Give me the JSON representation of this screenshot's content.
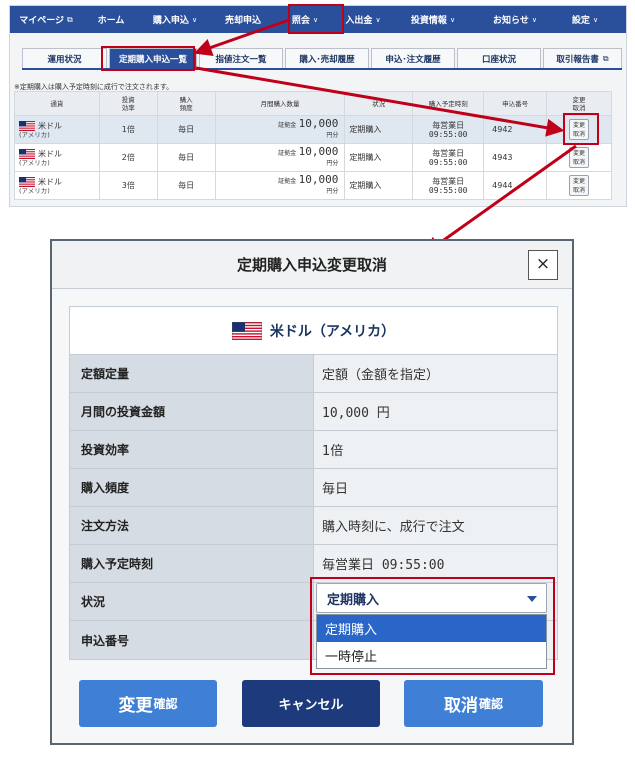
{
  "nav": {
    "items": [
      {
        "label": "マイページ",
        "suffix": "ext"
      },
      {
        "label": "ホーム",
        "suffix": ""
      },
      {
        "label": "購入申込",
        "suffix": "chev"
      },
      {
        "label": "売却申込",
        "suffix": ""
      },
      {
        "label": "照会",
        "suffix": "chev"
      },
      {
        "label": "入出金",
        "suffix": "chev"
      },
      {
        "label": "投資情報",
        "suffix": "chev"
      },
      {
        "label": "お知らせ",
        "suffix": "chev"
      },
      {
        "label": "設定",
        "suffix": "chev"
      }
    ]
  },
  "tabs": [
    {
      "label": "運用状況",
      "active": false,
      "ext": false
    },
    {
      "label": "定期購入申込一覧",
      "active": true,
      "ext": false
    },
    {
      "label": "指値注文一覧",
      "active": false,
      "ext": false
    },
    {
      "label": "購入･売却履歴",
      "active": false,
      "ext": false
    },
    {
      "label": "申込･注文履歴",
      "active": false,
      "ext": false
    },
    {
      "label": "口座状況",
      "active": false,
      "ext": false
    },
    {
      "label": "取引報告書",
      "active": false,
      "ext": true
    }
  ],
  "note": "※定期購入は購入予定時刻に成行で注文されます。",
  "table": {
    "headers": [
      "通貨",
      "投資\n効率",
      "購入\n頻度",
      "月間購入数量",
      "状況",
      "購入予定時刻",
      "申込番号",
      "変更\n取消"
    ],
    "rows": [
      {
        "currency": "米ドル",
        "region": "(アメリカ)",
        "efficiency": "1倍",
        "frequency": "毎日",
        "amount_label": "証拠金",
        "amount": "10,000",
        "amount_unit": "円分",
        "status": "定期購入",
        "time_day": "毎営業日",
        "time": "09:55:00",
        "id": "4942",
        "action": "変更\n取消"
      },
      {
        "currency": "米ドル",
        "region": "(アメリカ)",
        "efficiency": "2倍",
        "frequency": "毎日",
        "amount_label": "証拠金",
        "amount": "10,000",
        "amount_unit": "円分",
        "status": "定期購入",
        "time_day": "毎営業日",
        "time": "09:55:00",
        "id": "4943",
        "action": "変更\n取消"
      },
      {
        "currency": "米ドル",
        "region": "(アメリカ)",
        "efficiency": "3倍",
        "frequency": "毎日",
        "amount_label": "証拠金",
        "amount": "10,000",
        "amount_unit": "円分",
        "status": "定期購入",
        "time_day": "毎営業日",
        "time": "09:55:00",
        "id": "4944",
        "action": "変更\n取消"
      }
    ]
  },
  "modal": {
    "title": "定期購入申込変更取消",
    "close": "×",
    "currency": "米ドル（アメリカ）",
    "rows": [
      {
        "label": "定額定量",
        "value": "定額（金額を指定）",
        "mono": false
      },
      {
        "label": "月間の投資金額",
        "value": "10,000 円",
        "mono": true
      },
      {
        "label": "投資効率",
        "value": "1倍",
        "mono": false
      },
      {
        "label": "購入頻度",
        "value": "毎日",
        "mono": false
      },
      {
        "label": "注文方法",
        "value": "購入時刻に、成行で注文",
        "mono": false
      },
      {
        "label": "購入予定時刻",
        "value": "毎営業日 09:55:00",
        "mono": true
      },
      {
        "label": "状況",
        "value": "",
        "mono": false
      },
      {
        "label": "申込番号",
        "value": "",
        "mono": false
      }
    ],
    "status_select": {
      "value": "定期購入",
      "options": [
        "定期購入",
        "一時停止"
      ],
      "selected_index": 0
    },
    "buttons": {
      "change_main": "変更",
      "change_small": "確認",
      "cancel": "キャンセル",
      "delete_main": "取消",
      "delete_small": "確認"
    }
  },
  "colors": {
    "nav_bg": "#2a4f9b",
    "annotation_red": "#c00018",
    "primary_button": "#3f7fd6",
    "cancel_button": "#1d3a7c"
  }
}
